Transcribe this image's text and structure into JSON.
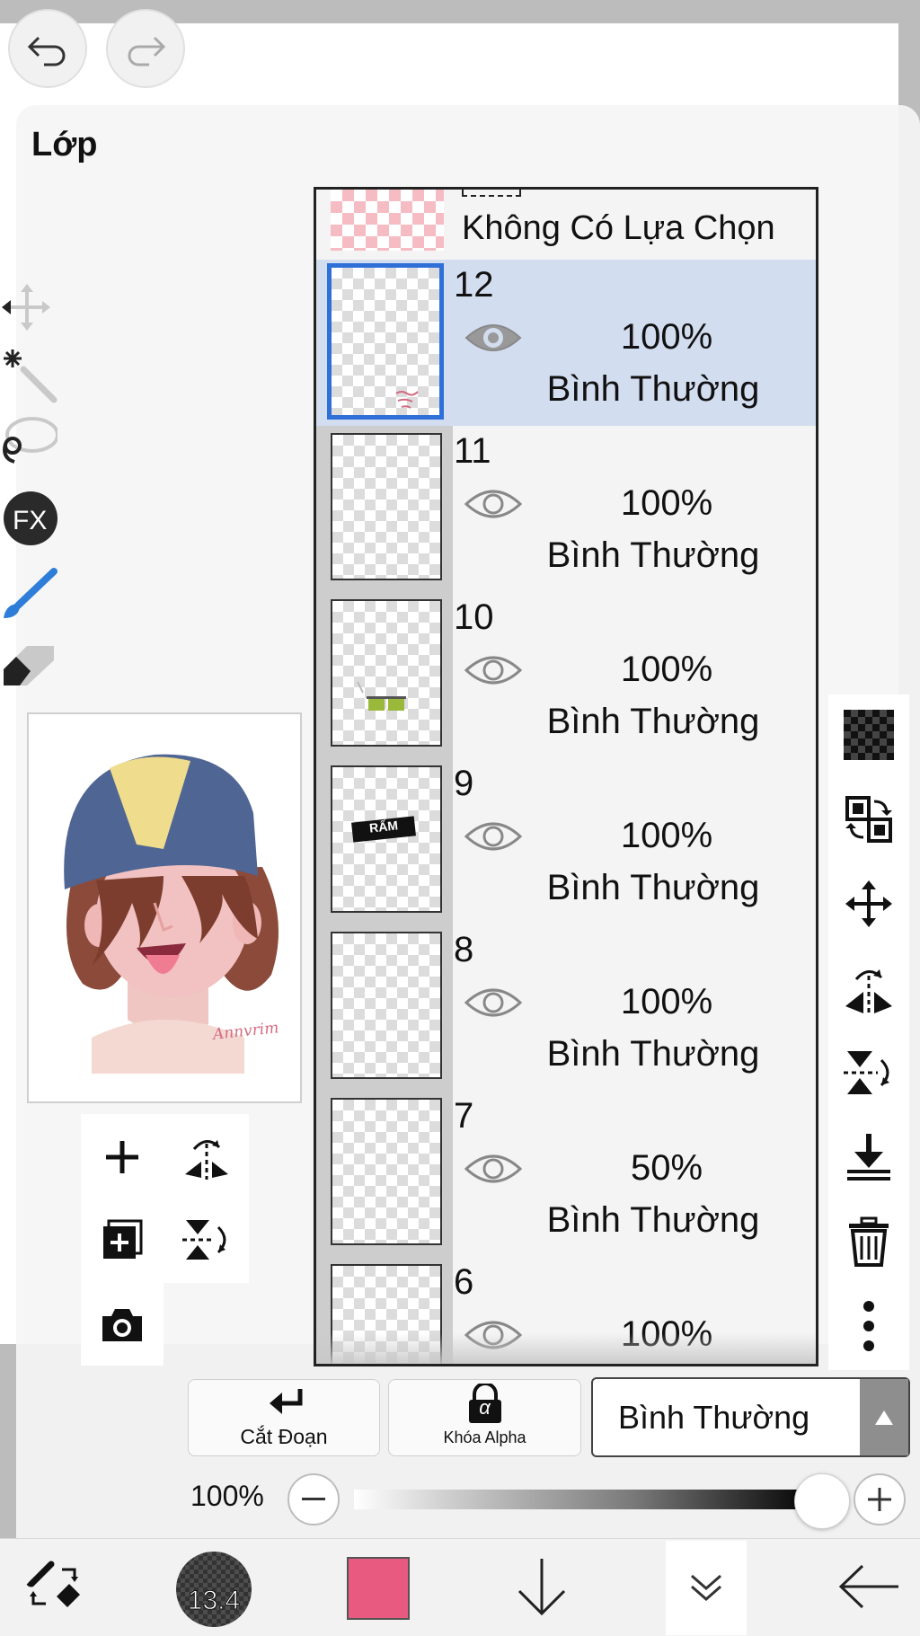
{
  "panel": {
    "title": "Lớp"
  },
  "selection_layer": {
    "label": "Không Có Lựa Chọn"
  },
  "layers": [
    {
      "number": "12",
      "opacity": "100%",
      "mode": "Bình Thường",
      "selected": true,
      "visible": true
    },
    {
      "number": "11",
      "opacity": "100%",
      "mode": "Bình Thường",
      "selected": false,
      "visible": true
    },
    {
      "number": "10",
      "opacity": "100%",
      "mode": "Bình Thường",
      "selected": false,
      "visible": true
    },
    {
      "number": "9",
      "opacity": "100%",
      "mode": "Bình Thường",
      "selected": false,
      "visible": true
    },
    {
      "number": "8",
      "opacity": "100%",
      "mode": "Bình Thường",
      "selected": false,
      "visible": true
    },
    {
      "number": "7",
      "opacity": "50%",
      "mode": "Bình Thường",
      "selected": false,
      "visible": true
    },
    {
      "number": "6",
      "opacity": "100%",
      "mode": "",
      "selected": false,
      "visible": true
    }
  ],
  "thumb_texts": {
    "layer9": "RẤM",
    "preview_signature": "Annvrim"
  },
  "bottom_buttons": {
    "clipping": "Cắt Đoạn",
    "alpha_lock": "Khóa Alpha",
    "alpha_symbol": "α"
  },
  "blend_mode": {
    "selected": "Bình Thường"
  },
  "opacity_slider": {
    "label": "100%",
    "value": 1.0
  },
  "toolbar": {
    "brush_size": "13.4",
    "current_color": "#e85a7f"
  },
  "icons": {
    "top": [
      "undo-icon",
      "redo-icon"
    ],
    "left_tools": [
      "move-tool-icon",
      "magic-wand-icon",
      "lasso-icon",
      "fx-icon",
      "brush-icon",
      "eraser-icon"
    ],
    "layer_actions": [
      "add-layer-icon",
      "flip-horizontal-icon",
      "add-layer-copy-icon",
      "flip-vertical-icon",
      "camera-icon"
    ],
    "right_tools": [
      "transparency-icon",
      "swap-layer-icon",
      "move-icon",
      "flip-h-icon",
      "flip-v-icon",
      "merge-down-icon",
      "trash-icon",
      "more-icon"
    ],
    "bottom_bar": [
      "tool-switch-icon",
      "brush-size-indicator",
      "color-swatch",
      "arrow-down-icon",
      "chevron-double-down-icon",
      "back-arrow-icon"
    ]
  }
}
